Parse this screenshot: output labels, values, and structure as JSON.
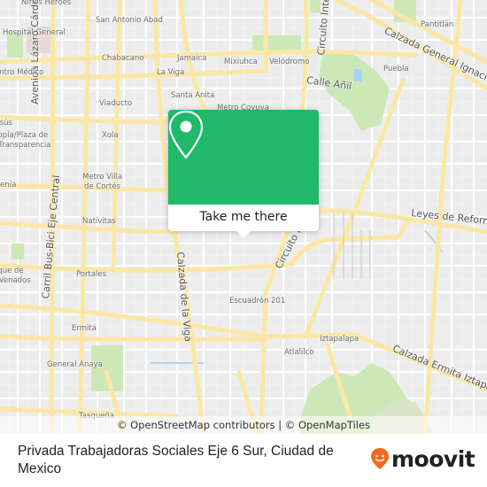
{
  "map": {
    "colors": {
      "background": "#ececec",
      "road_major": "#fbe7a4",
      "road_minor": "#ffffff",
      "park": "#cde8b7",
      "water": "#a9d3f2",
      "hill": "#dbe3c6"
    },
    "labels": {
      "ninos_heroes": "Niños Héroes",
      "san_antonio_abad": "San Antonio Abad",
      "hospital_general": "Hospital General",
      "avenida_lazaro_cardenas": "Avenida Lázaro Cárdenas",
      "chabacano": "Chabacano",
      "jamaica": "Jamaica",
      "mixiuhca": "Mixiuhca",
      "velodromo": "Velódromo",
      "centro_medico": "Centro Médico",
      "la_viga": "La Viga",
      "circuito_interior_top": "Circuito Interior",
      "pantitlan": "Pantitlán",
      "calzada_general_ignacio": "Calzada General Ignacio Zaragoza",
      "puebla": "Puebla",
      "calle_anil": "Calle Añil",
      "santa_anita": "Santa Anita",
      "viaducto": "Viaducto",
      "metro_coyuya": "Metro Coyuya",
      "jesus": "Jesús",
      "plaza_transparencia": "Utopía/Plaza de\nla Transparencia",
      "xola": "Xola",
      "eugenia": "Eugenia",
      "metro_villa_cortes": "Metro Villa\nde Cortés",
      "eje_central": "Carril Bus-Bici Eje Central",
      "leyes_reforma": "Leyes de Reforma",
      "nativitas": "Nativitas",
      "circuito_interior_mid": "Circuito Interior",
      "parque_venados": "Parque de\nlos Venados",
      "portales": "Portales",
      "calzada_viga": "Calzada de la Viga",
      "escuadron_201": "Escuadrón 201",
      "ermita": "Ermita",
      "iztapalapa": "Iztapalapa",
      "atlalilco": "Atlalilco",
      "calzada_ermita": "Calzada Ermita Iztapalapa",
      "general_anaya": "General Anaya",
      "tasquena": "Tasqueña"
    },
    "attribution": "© OpenStreetMap contributors | © OpenMapTiles"
  },
  "popup": {
    "icon": "map-pin-icon",
    "button_label": "Take me there",
    "accent_color": "#1fb969"
  },
  "footer": {
    "address": "Privada Trabajadoras Sociales Eje 6 Sur, Ciudad de Mexico",
    "logo_text": "moovit",
    "logo_icon": "moovit-smiley-pin-icon",
    "logo_color": "#f26a21"
  }
}
